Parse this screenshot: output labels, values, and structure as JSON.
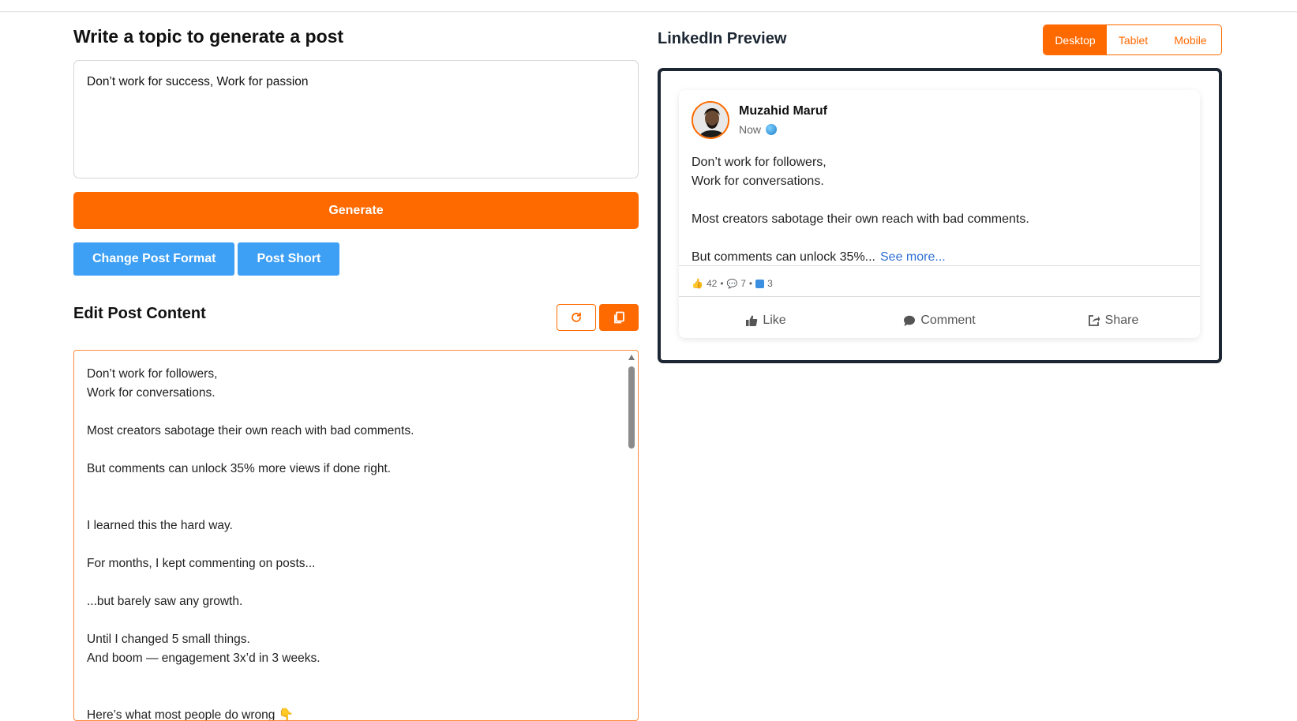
{
  "left": {
    "topic_heading": "Write a topic to generate a post",
    "topic_value": "Don’t work for success,  Work for passion",
    "generate_label": "Generate",
    "buttons": [
      "Change Post Format",
      "Post Short"
    ],
    "edit_heading": "Edit Post Content",
    "refresh_icon": "refresh-icon",
    "copy_icon": "copy-icon",
    "editor_lines": [
      "Don’t work for followers,",
      "Work for conversations.",
      "",
      "Most creators sabotage their own reach with bad comments.",
      "",
      "But comments can unlock 35% more views if done right.",
      "",
      "",
      "I learned this the hard way.",
      "",
      "For months, I kept commenting on posts...",
      "",
      "...but barely saw any growth.",
      "",
      "Until I changed 5 small things.",
      "And boom — engagement 3x’d in 3 weeks.",
      "",
      "",
      "Here’s what most people do wrong 👇"
    ]
  },
  "preview": {
    "title": "LinkedIn Preview",
    "tabs": [
      "Desktop",
      "Tablet",
      "Mobile"
    ],
    "active_tab": "Desktop",
    "author": "Muzahid Maruf",
    "time": "Now",
    "post_lines": [
      "Don’t work for followers,",
      "Work for conversations.",
      "",
      "Most creators sabotage their own reach with bad comments.",
      "",
      "But comments can unlock 35%..."
    ],
    "see_more": "See more...",
    "stats": {
      "likes": "42",
      "comments": "7",
      "reposts": "3"
    },
    "actions": [
      "Like",
      "Comment",
      "Share"
    ]
  },
  "colors": {
    "accent": "#ff6a00",
    "blue": "#3ea0f5",
    "frame": "#1d2733",
    "link": "#2d6fd6"
  }
}
